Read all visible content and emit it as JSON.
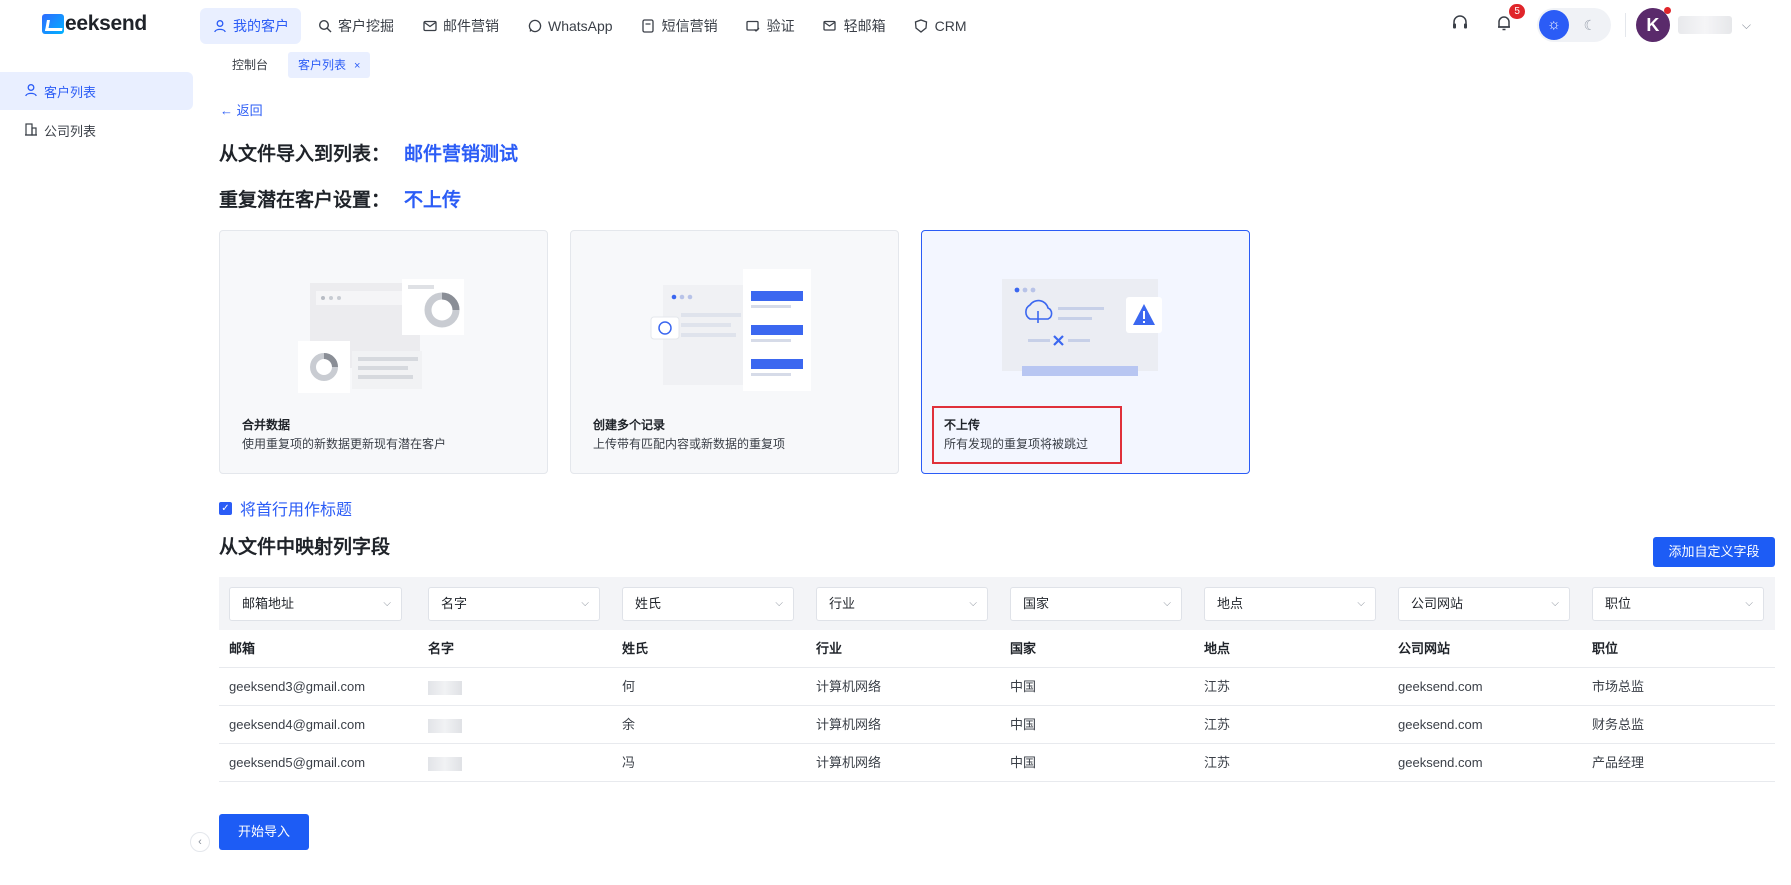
{
  "app": {
    "logo_text": "eeksend"
  },
  "nav": [
    {
      "label": "我的客户",
      "icon": "user-icon",
      "active": true
    },
    {
      "label": "客户挖掘",
      "icon": "search-icon"
    },
    {
      "label": "邮件营销",
      "icon": "mail-icon"
    },
    {
      "label": "WhatsApp",
      "icon": "whatsapp-icon"
    },
    {
      "label": "短信营销",
      "icon": "sms-icon"
    },
    {
      "label": "验证",
      "icon": "verify-mail-icon"
    },
    {
      "label": "轻邮箱",
      "icon": "light-mail-icon"
    },
    {
      "label": "CRM",
      "icon": "crm-icon"
    }
  ],
  "header": {
    "notification_count": "5",
    "avatar_letter": "K"
  },
  "tabs": [
    {
      "label": "控制台"
    },
    {
      "label": "客户列表",
      "close": "×"
    }
  ],
  "sidebar": {
    "items": [
      {
        "label": "客户列表",
        "icon": "user-icon",
        "active": true
      },
      {
        "label": "公司列表",
        "icon": "building-icon"
      }
    ]
  },
  "page": {
    "back_label": "返回",
    "import_label": "从文件导入到列表：",
    "import_value": "邮件营销测试",
    "dup_label": "重复潜在客户设置：",
    "dup_value": "不上传",
    "cards": [
      {
        "title": "合并数据",
        "desc": "使用重复项的新数据更新现有潜在客户"
      },
      {
        "title": "创建多个记录",
        "desc": "上传带有匹配内容或新数据的重复项"
      },
      {
        "title": "不上传",
        "desc": "所有发现的重复项将被跳过"
      }
    ],
    "header_checkbox_label": "将首行用作标题",
    "map_title": "从文件中映射列字段",
    "add_field_button": "添加自定义字段",
    "start_button": "开始导入"
  },
  "mapping": {
    "selects": [
      "邮箱地址",
      "名字",
      "姓氏",
      "行业",
      "国家",
      "地点",
      "公司网站",
      "职位"
    ],
    "columns": [
      "邮箱",
      "名字",
      "姓氏",
      "行业",
      "国家",
      "地点",
      "公司网站",
      "职位"
    ],
    "rows": [
      [
        "geeksend3@gmail.com",
        "",
        "何",
        "计算机网络",
        "中国",
        "江苏",
        "geeksend.com",
        "市场总监"
      ],
      [
        "geeksend4@gmail.com",
        "",
        "余",
        "计算机网络",
        "中国",
        "江苏",
        "geeksend.com",
        "财务总监"
      ],
      [
        "geeksend5@gmail.com",
        "",
        "冯",
        "计算机网络",
        "中国",
        "江苏",
        "geeksend.com",
        "产品经理"
      ]
    ]
  },
  "colors": {
    "accent": "#2b5cf6",
    "primary_button": "#1d5cf5",
    "highlight_box": "#e0303a"
  }
}
